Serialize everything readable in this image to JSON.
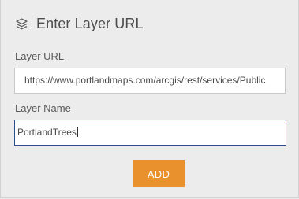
{
  "header": {
    "icon": "layers-icon",
    "title": "Enter Layer URL"
  },
  "layer_url": {
    "label": "Layer URL",
    "value": "https://www.portlandmaps.com/arcgis/rest/services/Public"
  },
  "layer_name": {
    "label": "Layer Name",
    "value": "PortlandTrees"
  },
  "actions": {
    "add_label": "ADD"
  },
  "colors": {
    "accent": "#e8912d",
    "focus_border": "#2f4e8c",
    "panel_bg": "#ececec"
  }
}
